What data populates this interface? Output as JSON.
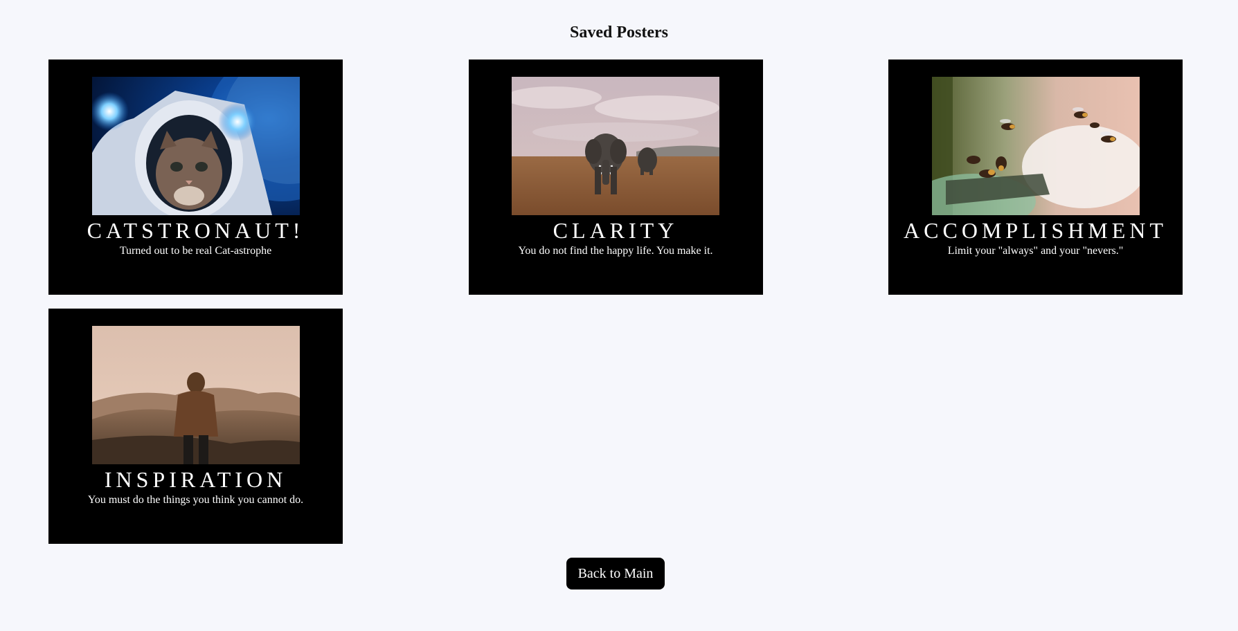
{
  "page": {
    "title": "Saved Posters",
    "back_label": "Back to Main"
  },
  "posters": [
    {
      "image": "astronaut-cat-photo",
      "title": "CATSTRONAUT!",
      "quote": "Turned out to be real Cat-astrophe"
    },
    {
      "image": "elephant-savanna-photo",
      "title": "CLARITY",
      "quote": "You do not find the happy life. You make it."
    },
    {
      "image": "bees-photo",
      "title": "ACCOMPLISHMENT",
      "quote": "Limit your \"always\" and your \"nevers.\""
    },
    {
      "image": "person-mountains-photo",
      "title": "INSPIRATION",
      "quote": "You must do the things you think you cannot do."
    }
  ],
  "colors": {
    "background": "#f6f7fc",
    "poster": "#000000",
    "poster_text": "#ffffff",
    "button": "#000000"
  }
}
